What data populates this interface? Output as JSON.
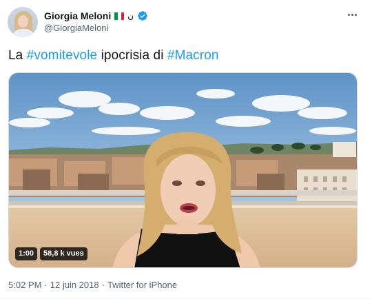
{
  "author": {
    "display_name": "Giorgia Meloni",
    "handle": "@GiorgiaMeloni",
    "flag_emoji": "italy-flag",
    "extra_emoji": "ن",
    "verified": true
  },
  "tweet": {
    "text_prefix": "La ",
    "hashtag_1": "#vomitevole",
    "text_middle": " ipocrisia di ",
    "hashtag_2": "#Macron"
  },
  "media": {
    "type": "video",
    "duration": "1:00",
    "views": "58,8 k vues"
  },
  "meta": {
    "time": "5:02 PM",
    "separator_1": "·",
    "date": "12 juin 2018",
    "separator_2": "·",
    "source": "Twitter for iPhone"
  },
  "colors": {
    "hashtag": "#1d9bf0",
    "verified": "#1d9bf0",
    "secondary_text": "#536471"
  }
}
